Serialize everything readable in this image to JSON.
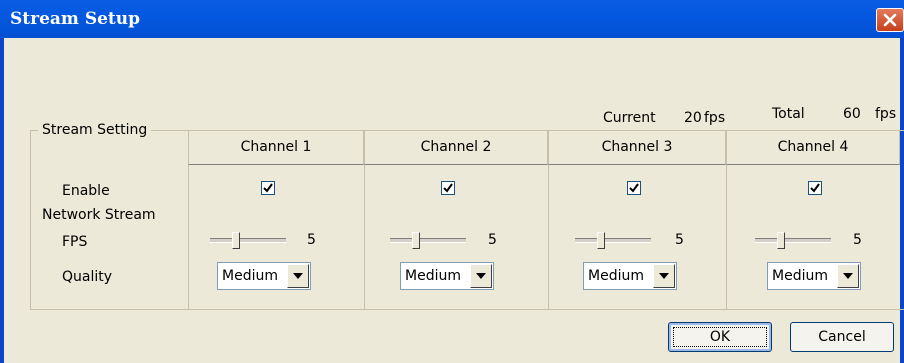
{
  "window": {
    "title": "Stream Setup"
  },
  "summary": {
    "current_label": "Current",
    "current_value": "20",
    "current_unit": "fps",
    "total_label": "Total",
    "total_value": "60",
    "total_unit": "fps"
  },
  "group": {
    "title": "Stream Setting",
    "row_labels": {
      "enable": "Enable",
      "network_stream": "Network Stream",
      "fps": "FPS",
      "quality": "Quality"
    }
  },
  "channels": [
    {
      "name": "Channel 1",
      "enabled": true,
      "fps": "5",
      "quality": "Medium"
    },
    {
      "name": "Channel 2",
      "enabled": true,
      "fps": "5",
      "quality": "Medium"
    },
    {
      "name": "Channel 3",
      "enabled": true,
      "fps": "5",
      "quality": "Medium"
    },
    {
      "name": "Channel 4",
      "enabled": true,
      "fps": "5",
      "quality": "Medium"
    }
  ],
  "buttons": {
    "ok": "OK",
    "cancel": "Cancel"
  },
  "colors": {
    "titlebar": "#0458e0",
    "window_bg": "#ece9d8",
    "close_button": "#c4401f"
  },
  "icons": {
    "close": "close-x-icon",
    "check": "checkmark-icon",
    "dropdown": "triangle-down-icon"
  }
}
